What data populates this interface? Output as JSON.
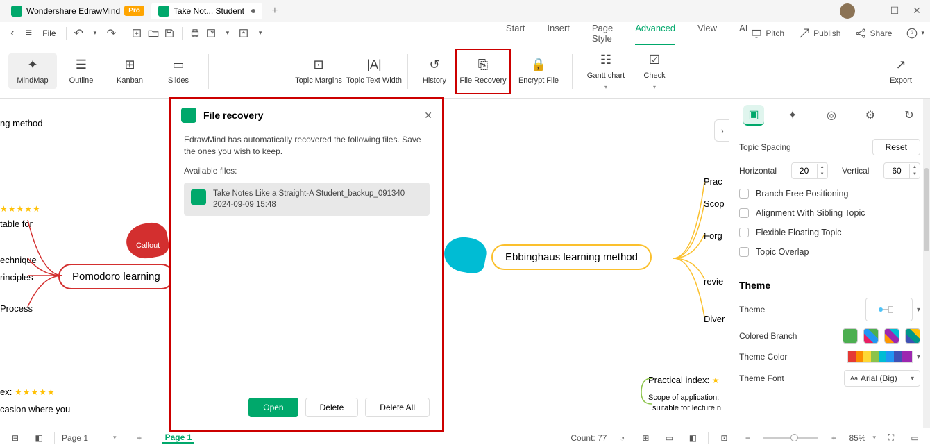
{
  "titlebar": {
    "tab1": "Wondershare EdrawMind",
    "pro": "Pro",
    "tab2": "Take Not... Student"
  },
  "toolbar": {
    "file": "File"
  },
  "menus": {
    "start": "Start",
    "insert": "Insert",
    "page_style": "Page Style",
    "advanced": "Advanced",
    "view": "View",
    "ai": "AI"
  },
  "right_actions": {
    "pitch": "Pitch",
    "publish": "Publish",
    "share": "Share"
  },
  "views": {
    "mindmap": "MindMap",
    "outline": "Outline",
    "kanban": "Kanban",
    "slides": "Slides"
  },
  "tools": {
    "topic_margins": "Topic Margins",
    "topic_text_width": "Topic Text Width",
    "history": "History",
    "file_recovery": "File Recovery",
    "encrypt": "Encrypt File",
    "gantt": "Gantt chart",
    "check": "Check",
    "export": "Export"
  },
  "modal": {
    "title": "File recovery",
    "desc": "EdrawMind has automatically recovered the following files. Save the ones you wish to keep.",
    "available": "Available files:",
    "file_name": "Take Notes Like a Straight-A Student_backup_091340",
    "file_date": "2024-09-09 15:48",
    "open": "Open",
    "delete": "Delete",
    "delete_all": "Delete All"
  },
  "canvas": {
    "pomodoro": "Pomodoro learning",
    "ebbinghaus": "Ebbinghaus learning method",
    "callout": "Callout",
    "t1": "ng method",
    "t2": "table for",
    "t3": "echnique",
    "t4": "rinciples",
    "t5": "Process",
    "t6": "ex:",
    "t7": "casion where you",
    "r1": "Prac",
    "r2": "Scop",
    "r3": "Forg",
    "r4": "revie",
    "r5": "Diver",
    "r6": "Practical index:",
    "r7": "Scope of application:",
    "r8": "suitable for lecture n"
  },
  "panel": {
    "topic_spacing": "Topic Spacing",
    "reset": "Reset",
    "horizontal": "Horizontal",
    "hval": "20",
    "vertical": "Vertical",
    "vval": "60",
    "branch_free": "Branch Free Positioning",
    "align_sibling": "Alignment With Sibling Topic",
    "flexible": "Flexible Floating Topic",
    "overlap": "Topic Overlap",
    "theme_hdr": "Theme",
    "theme": "Theme",
    "colored_branch": "Colored Branch",
    "theme_color": "Theme Color",
    "theme_font": "Theme Font",
    "font": "Arial (Big)"
  },
  "status": {
    "page_sel": "Page 1",
    "page_tab": "Page 1",
    "count": "Count: 77",
    "zoom": "85%"
  }
}
